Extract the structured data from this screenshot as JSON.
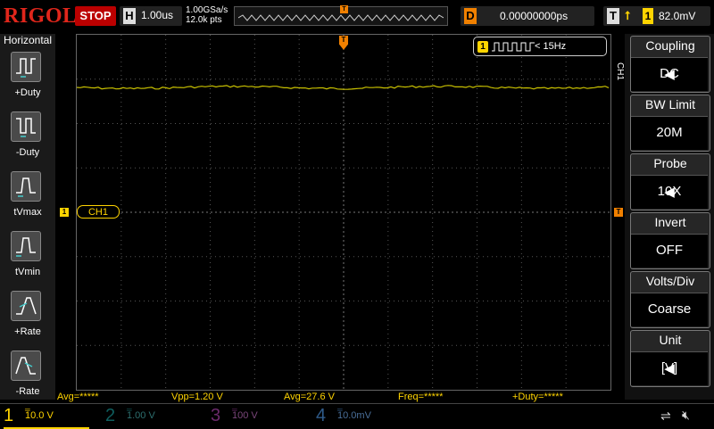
{
  "brand": "RIGOL",
  "run_state": "STOP",
  "horizontal_box": {
    "key": "H",
    "value": "1.00us"
  },
  "sample_rate": "1.00GSa/s",
  "memory_depth": "12.0k pts",
  "delay_box": {
    "key": "D",
    "value": "0.00000000ps"
  },
  "trigger_box": {
    "key": "T",
    "source": "1",
    "level": "82.0mV"
  },
  "left_menu": {
    "title": "Horizontal",
    "items": [
      {
        "label": "+Duty"
      },
      {
        "label": "-Duty"
      },
      {
        "label": "tVmax"
      },
      {
        "label": "tVmin"
      },
      {
        "label": "+Rate"
      },
      {
        "label": "-Rate"
      }
    ]
  },
  "channel_label": "CH1",
  "channel_marker": "1",
  "trigger_marker": "T",
  "freq_badge": {
    "channel": "1",
    "text": "< 15Hz"
  },
  "right_menu": {
    "channel_tab": "CH1",
    "items": [
      {
        "title": "Coupling",
        "value": "DC"
      },
      {
        "title": "BW Limit",
        "value": "20M"
      },
      {
        "title": "Probe",
        "value": "10X"
      },
      {
        "title": "Invert",
        "value": "OFF"
      },
      {
        "title": "Volts/Div",
        "value": "Coarse"
      },
      {
        "title": "Unit",
        "value": "[V]"
      }
    ]
  },
  "measurements": [
    {
      "text": "Avg=*****"
    },
    {
      "text": "Vpp=1.20 V"
    },
    {
      "text": "Avg=27.6 V"
    },
    {
      "text": "Freq=*****"
    },
    {
      "text": "+Duty=*****"
    }
  ],
  "channels": [
    {
      "num": "1",
      "scale": "10.0 V",
      "color": "#ffd400"
    },
    {
      "num": "2",
      "scale": "1.00 V",
      "color": "#16b0b0"
    },
    {
      "num": "3",
      "scale": "100 V",
      "color": "#c040c0"
    },
    {
      "num": "4",
      "scale": "10.0mV",
      "color": "#3b8be0"
    }
  ],
  "colors": {
    "ch1": "#ffd400",
    "trigger": "#f08000",
    "stop": "#bb0000",
    "brand": "#e0261b",
    "measure": "#ffd400"
  }
}
